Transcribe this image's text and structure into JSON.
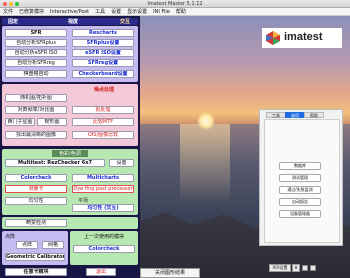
{
  "window": {
    "title": "Imatest Master 5.1.12"
  },
  "menu": [
    "文件",
    "已修复模块",
    "Interactive/Post",
    "工具",
    "设置",
    "显示设置",
    "INI File",
    "帮助"
  ],
  "left": {
    "header": {
      "col1": "固定",
      "col2": "视度",
      "col3": "交互"
    },
    "row_sfr": {
      "a": "SFR",
      "b": "Rescharts"
    },
    "row_sfrplus": {
      "a": "自动分析SFRplus",
      "b": "SFRplus设置"
    },
    "row_esfr": {
      "a": "自动分析eSFR ISO",
      "b": "eSFR ISO设置"
    },
    "row_sfrreg": {
      "a": "自动分析SFRreg",
      "b": "SFRreg设置"
    },
    "row_checker": {
      "a": "棋盘格自动",
      "b": "Checkerboard设置"
    },
    "noise_label": "噪点处理",
    "row_noise1": {
      "a": "随机图/拓扑图"
    },
    "row_noise2": {
      "a": "对数频率/对比图",
      "b": "批处理"
    },
    "row_noise3": {
      "a": "西门子星图",
      "b": "楔形图",
      "c": "比较MTF"
    },
    "row_noise4": {
      "a": "找出最清晰的图像",
      "b": "OIS/图像比较"
    },
    "color_label": "色彩/色调",
    "row_multi": {
      "a": "Multitest: RezChecker 6x7",
      "b": "设置"
    },
    "row_color1": {
      "a": "Colorcheck",
      "b": "Multicharts"
    },
    "row_color2": {
      "a": "测量卡",
      "b": "Dye fing post processor"
    },
    "uniform_label": "平场",
    "row_uni": {
      "a": "均匀性",
      "b": "均匀性 (交互)"
    },
    "row_dist": {
      "a": "畸变检测"
    },
    "pixels_label": "点阵",
    "row_geo1": {
      "a": "点阵",
      "b": "网格"
    },
    "row_geo2": {
      "a": "Geometric Calibrator"
    },
    "prev_label": "上一次使用的模块",
    "row_prev": {
      "a": "Colorcheck"
    },
    "row_last": {
      "a": "任意卡模块",
      "b": "退出"
    }
  },
  "logo": {
    "text": "imatest"
  },
  "settings": {
    "tabs": [
      "工具",
      "选项",
      "帮助"
    ],
    "active_tab": 1,
    "buttons": [
      "数据库",
      "测试管理",
      "通过/失败监测",
      "自动报告",
      "设备管理器"
    ]
  },
  "bottom": {
    "close": "关闭图形结果",
    "roi": "ROI设置",
    "roi_x": "x"
  },
  "colors": {
    "panel": "#191545",
    "accent_blue": "#1e6ce0",
    "sec_green": "#b7e8b1",
    "sec_pink": "#f3c9d7",
    "sec_purple": "#c7bcf1"
  }
}
